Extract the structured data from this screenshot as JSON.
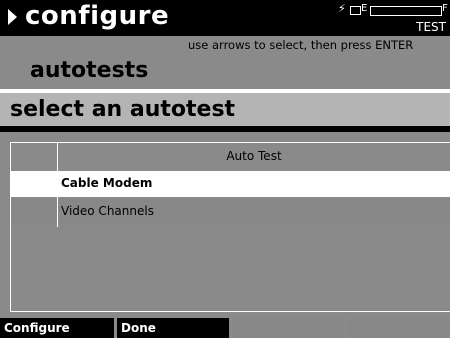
{
  "header": {
    "title": "configure",
    "mode": "TEST",
    "battery": {
      "empty_label": "E",
      "full_label": "F"
    }
  },
  "hint": "use arrows to select, then press ENTER",
  "section_title": "autotests",
  "prompt": "select an autotest",
  "list": {
    "column_header": "Auto Test",
    "items": [
      "Cable Modem",
      "Video Channels"
    ],
    "selected_index": 0
  },
  "softkeys": [
    "Configure",
    "Done",
    "",
    ""
  ]
}
